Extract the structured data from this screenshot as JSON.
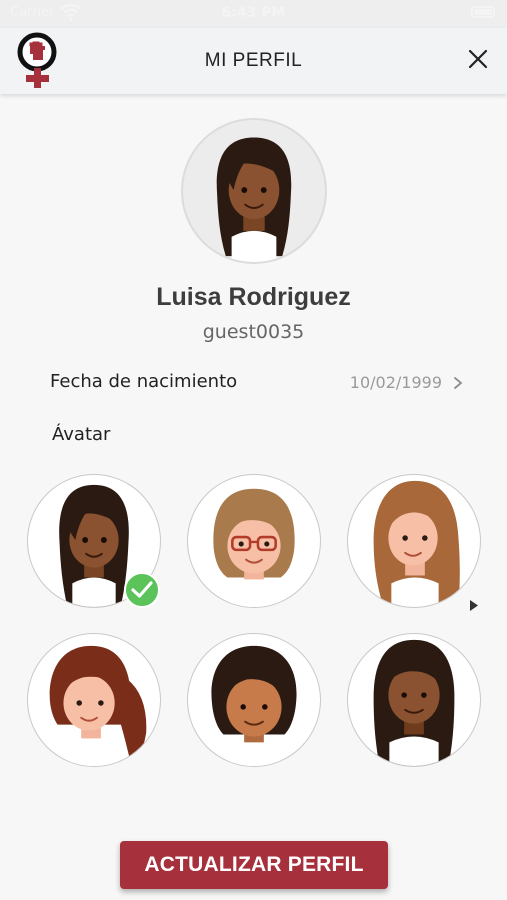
{
  "status_bar": {
    "carrier": "Carrier",
    "time": "6:43 PM"
  },
  "header": {
    "title": "MI PERFIL",
    "logo_icon": "feminist-fist-logo-icon",
    "close_icon": "close-icon"
  },
  "profile": {
    "name": "Luisa Rodriguez",
    "username": "guest0035",
    "avatar": "avatar-1"
  },
  "birth_date": {
    "label": "Fecha de nacimiento",
    "value": "10/02/1999",
    "chevron_icon": "chevron-right-icon"
  },
  "avatar_picker": {
    "label": "Ávatar",
    "selected": "avatar-1",
    "options": [
      "avatar-1",
      "avatar-2",
      "avatar-3",
      "avatar-4",
      "avatar-5",
      "avatar-6"
    ]
  },
  "actions": {
    "update_label": "ACTUALIZAR PERFIL"
  },
  "colors": {
    "accent": "#a6313d",
    "check": "#5bc35a",
    "header_bg": "#f2f3f5",
    "background": "#f7f7f7"
  }
}
